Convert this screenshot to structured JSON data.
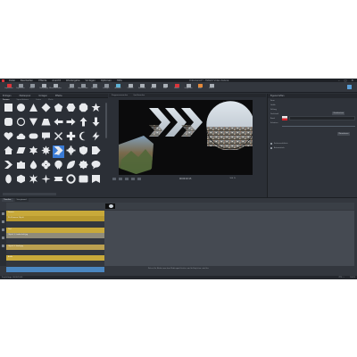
{
  "app": {
    "title": "Unbenannt* - MAGIX Video deluxe",
    "menu": [
      "Datei",
      "Bearbeiten",
      "Effekte",
      "Ansicht",
      "Wiedergabe",
      "Vorlagen",
      "Optionen",
      "Hilfe"
    ],
    "window_controls": [
      "–",
      "□",
      "✕"
    ]
  },
  "toolbar": {
    "buttons": [
      {
        "label": "Importieren",
        "icon": "import-icon",
        "color": "#d9353b"
      },
      {
        "label": "Exportieren",
        "icon": "export-icon",
        "color": "#8e959d"
      },
      {
        "label": "Projekt",
        "icon": "project-icon",
        "color": "#8e959d"
      },
      {
        "label": "Rückgängig",
        "icon": "undo-icon",
        "color": "#aab0b7"
      },
      {
        "label": "Wiederherstellen",
        "icon": "redo-icon",
        "color": "#aab0b7"
      },
      {
        "label": "Löschen",
        "icon": "delete-icon",
        "color": "#8e959d"
      },
      {
        "label": "Ausschneiden",
        "icon": "cut-icon",
        "color": "#8e959d"
      },
      {
        "label": "Kopieren",
        "icon": "copy-icon",
        "color": "#8e959d"
      },
      {
        "label": "Einfügen",
        "icon": "paste-icon",
        "color": "#8e959d"
      },
      {
        "label": "Auswahl",
        "icon": "select-icon",
        "color": "#5fb3d6"
      },
      {
        "label": "Trimmen",
        "icon": "trim-icon",
        "color": "#aab0b7"
      },
      {
        "label": "Schneiden",
        "icon": "split-icon",
        "color": "#aab0b7"
      },
      {
        "label": "Anfang",
        "icon": "start-icon",
        "color": "#aab0b7"
      },
      {
        "label": "Ende",
        "icon": "end-icon",
        "color": "#aab0b7"
      },
      {
        "label": "Marker",
        "icon": "marker-icon",
        "color": "#d9353b"
      },
      {
        "label": "Gruppieren",
        "icon": "group-icon",
        "color": "#aab0b7"
      },
      {
        "label": "Mixer",
        "icon": "mixer-icon",
        "color": "#e58a3a"
      },
      {
        "label": "Effekte",
        "icon": "fx-icon",
        "color": "#aab0b7"
      }
    ],
    "accent": "#5a9fd8"
  },
  "shapes_panel": {
    "tabs": [
      "Einfügen",
      "Medienpool",
      "Vorlagen",
      "Effekte"
    ],
    "sub_tabs": [
      "Formen",
      "Sprechblasen",
      "Linien",
      "Pfeile"
    ],
    "active_sub_tab": "Formen",
    "selected_shape": "Pfeil",
    "shapes": [
      "square",
      "circle",
      "triangle",
      "diamond",
      "pentagon",
      "hexagon",
      "octagon",
      "star",
      "rounded-square",
      "circle-outline",
      "triangle-down",
      "trapezoid",
      "arrow-left",
      "arrow-right",
      "arrow-up",
      "arrow-down",
      "heart",
      "cloud",
      "rounded-rect",
      "callout",
      "cross",
      "plus",
      "moon",
      "lightning",
      "house",
      "parallelogram",
      "star6",
      "star8",
      "chevron",
      "cog",
      "shield",
      "tag",
      "chevron-right",
      "puzzle",
      "droplet",
      "flower",
      "badge",
      "leaf",
      "seal",
      "bubble",
      "oval-tall",
      "cube",
      "burst",
      "sparkle",
      "ribbon",
      "ring",
      "plaque",
      "banner"
    ]
  },
  "preview": {
    "tabs": [
      "Programmmonitor",
      "Quellmonitor"
    ],
    "time": "00:00:02:15",
    "zoom": "100 %",
    "controls": [
      "play",
      "stop",
      "prev",
      "next",
      "loop"
    ]
  },
  "properties": {
    "title": "Eigenschaften",
    "rows": [
      "Form",
      "Größe",
      "Füllung",
      "Deckkraft",
      "Rand",
      "Schatten"
    ],
    "buttons": [
      "Zurücksetzen",
      "Übernehmen"
    ],
    "checkboxes": [
      "Seitenverhältnis",
      "Automatisch"
    ]
  },
  "timeline": {
    "tabs": [
      "Timeline",
      "Storyboard"
    ],
    "active_tab": "Timeline",
    "tracks": [
      {
        "label": "Formen",
        "color": "#c8a93a"
      },
      {
        "label": "Pfeil Formen Objekt",
        "color": "#b8992f"
      },
      {
        "label": "Titel",
        "color": "#c8a93a"
      },
      {
        "label": "Objekt 1: Landschaft.jpg",
        "color": "#8f8b7a"
      },
      {
        "label": "Objekt 2: Stadt.jpg",
        "color": "#bba050"
      },
      {
        "label": "Audio",
        "color": "#c8a93a"
      }
    ],
    "hint": "Ziehen Sie Medien aus dem Medienpool hierher, um Ihr Projekt zu erstellen.",
    "status_left": "Projektlänge: 00:00:10:00",
    "status_right": "CPU: —",
    "status_pct": "100 %"
  }
}
